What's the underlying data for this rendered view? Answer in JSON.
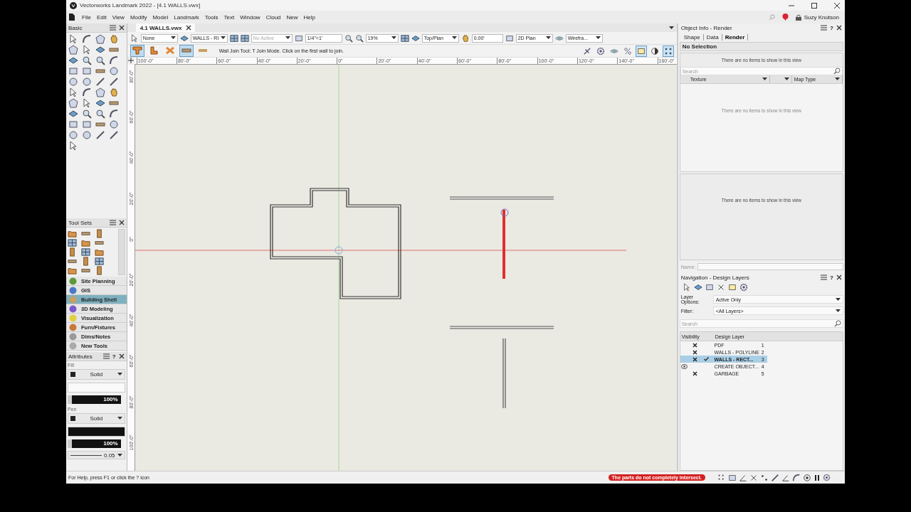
{
  "window": {
    "title": "Vectorworks Landmark 2022 - [4.1 WALLS.vwx]"
  },
  "menu": [
    "File",
    "Edit",
    "View",
    "Modify",
    "Model",
    "Landmark",
    "Tools",
    "Text",
    "Window",
    "Cloud",
    "New",
    "Help"
  ],
  "account": {
    "user": "Suzy Knutson"
  },
  "document_tabs": [
    {
      "label": "4.1 WALLS.vwx",
      "selected": true
    }
  ],
  "view_bar": {
    "class": "None",
    "layer": "WALLS - RI",
    "active_option": {
      "value": "No Active",
      "disabled": true
    },
    "scale": "1/4\"=1'",
    "zoom": "19%",
    "view": "Top/Plan",
    "rotation": "0.00'",
    "plane": "2D Plan",
    "render_mode": "Wirefra..."
  },
  "tool_bar": {
    "modes": [
      {
        "kind": "t-join",
        "selected": true
      },
      {
        "kind": "l-join",
        "selected": false
      },
      {
        "kind": "x-join",
        "selected": false
      },
      {
        "kind": "wall-cap",
        "selected": true
      },
      {
        "kind": "wall-plain",
        "selected": false
      }
    ],
    "hint": "Wall Join Tool: T Join Mode. Click on the first wall to join.",
    "options": [
      {
        "kind": "ruler",
        "selected": false
      },
      {
        "kind": "gear",
        "selected": false
      },
      {
        "kind": "planet",
        "selected": false
      },
      {
        "kind": "percent",
        "selected": false
      },
      {
        "kind": "frame",
        "selected": true
      },
      {
        "kind": "contrast",
        "selected": false
      },
      {
        "kind": "dots",
        "selected": true
      }
    ]
  },
  "rulers": {
    "top": [
      "100'-0\"",
      "80'-0\"",
      "60'-0\"",
      "40'-0\"",
      "20'-0\"",
      "0\"",
      "20'-0\"",
      "40'-0\"",
      "60'-0\"",
      "80'-0\"",
      "100'-0\"",
      "120'-0\"",
      "140'-0\"",
      "160'-0\""
    ],
    "left": [
      "80'-0\"",
      "60'-0\"",
      "40'-0\"",
      "20'-0\"",
      "0\"",
      "20'-0\"",
      "40'-0\"",
      "60'-0\"",
      "80'-0\"",
      "100'-0\""
    ]
  },
  "palettes": {
    "basic": {
      "title": "Basic"
    },
    "tool_sets": {
      "title": "Tool Sets",
      "items": [
        {
          "label": "Site Planning",
          "selected": false
        },
        {
          "label": "GIS",
          "selected": false
        },
        {
          "label": "Building Shell",
          "selected": true
        },
        {
          "label": "3D Modeling",
          "selected": false
        },
        {
          "label": "Visualization",
          "selected": false
        },
        {
          "label": "Furn/Fixtures",
          "selected": false
        },
        {
          "label": "Dims/Notes",
          "selected": false
        },
        {
          "label": "New Tools",
          "selected": false
        }
      ]
    },
    "attributes": {
      "title": "Attributes",
      "help": "?",
      "fill": {
        "label": "Fill",
        "style": "Solid",
        "opacity": "100%"
      },
      "pen": {
        "label": "Pen",
        "style": "Solid",
        "opacity": "100%",
        "thickness": "0.05"
      }
    }
  },
  "object_info": {
    "title": "Object Info - Render",
    "help": "?",
    "tabs": [
      {
        "label": "Shape",
        "selected": false
      },
      {
        "label": "Data",
        "selected": false
      },
      {
        "label": "Render",
        "selected": true
      }
    ],
    "selection": "No Selection",
    "empty_message": "There are no items to show in this view",
    "search": {
      "placeholder": "Search"
    },
    "columns": [
      {
        "label": "Texture"
      },
      {
        "label": "Map Type"
      }
    ],
    "list_message": "There are no items to show in this view",
    "preview_message": "There are no items to show in this view",
    "name_label": "Name:"
  },
  "navigation": {
    "title": "Navigation - Design Layers",
    "help": "?",
    "layer_options": {
      "label": "Layer Options:",
      "value": "Active Only"
    },
    "filter": {
      "label": "Filter:",
      "value": "<All Layers>"
    },
    "search": {
      "placeholder": "Search"
    },
    "columns": [
      "Visibility",
      "Design Layer"
    ],
    "layers": [
      {
        "name": "PDF",
        "number": "1",
        "visible": false,
        "active": false,
        "selected": false
      },
      {
        "name": "WALLS - POLYLINE",
        "number": "2",
        "visible": false,
        "active": false,
        "selected": false
      },
      {
        "name": "WALLS - RECT...",
        "number": "3",
        "visible": false,
        "active": true,
        "selected": true
      },
      {
        "name": "CREATE OBJECT...",
        "number": "4",
        "visible": true,
        "active": false,
        "selected": false
      },
      {
        "name": "GARBAGE",
        "number": "5",
        "visible": false,
        "active": false,
        "selected": false
      }
    ]
  },
  "status_bar": {
    "help": "For Help, press F1 or click the ? icon",
    "alert": "The parts do not completely intersect."
  }
}
